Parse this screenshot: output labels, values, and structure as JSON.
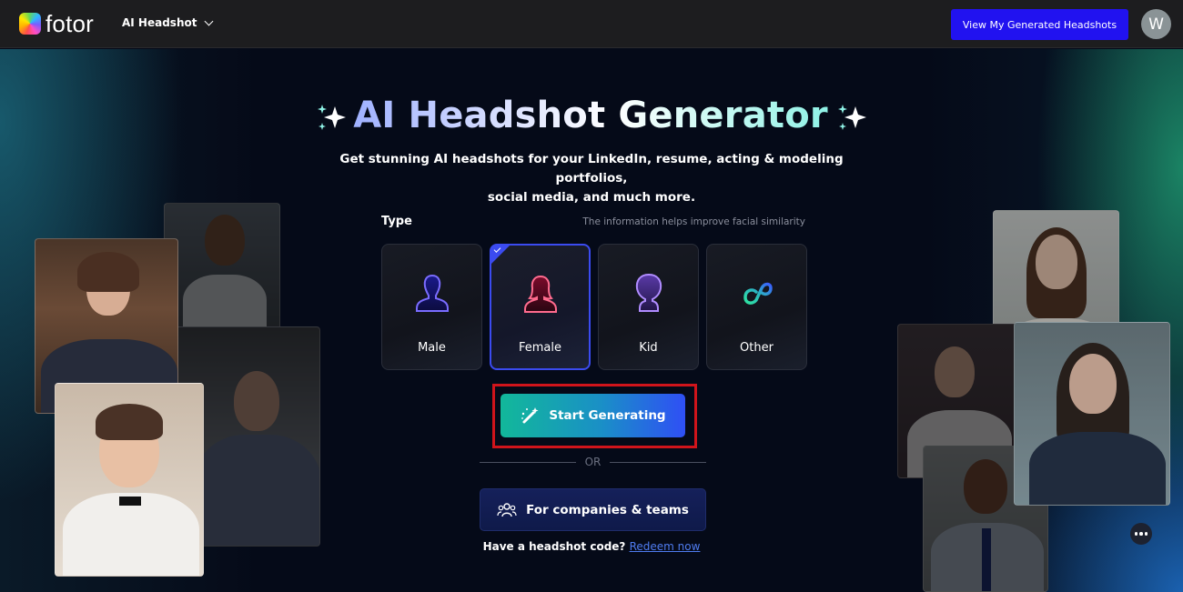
{
  "header": {
    "logo_text": "fotor",
    "nav_menu_label": "AI Headshot",
    "view_button_label": "View My Generated Headshots",
    "avatar_initial": "W"
  },
  "hero": {
    "title": "AI Headshot Generator",
    "subtitle_line1": "Get stunning AI headshots for your LinkedIn, resume, acting & modeling portfolios,",
    "subtitle_line2": "social media, and much more."
  },
  "type_section": {
    "label": "Type",
    "hint": "The information helps improve facial similarity",
    "selected": "Female",
    "options": [
      {
        "label": "Male",
        "icon": "male-person-icon",
        "color": "#6b5cf5"
      },
      {
        "label": "Female",
        "icon": "female-person-icon",
        "color": "#f0587a"
      },
      {
        "label": "Kid",
        "icon": "kid-person-icon",
        "color": "#a37cf7"
      },
      {
        "label": "Other",
        "icon": "infinity-loop-icon",
        "color": "#2fd38f"
      }
    ]
  },
  "actions": {
    "start_label": "Start Generating",
    "or_label": "OR",
    "companies_label": "For companies & teams",
    "redeem_prompt": "Have a headshot code?",
    "redeem_link": "Redeem now"
  },
  "colors": {
    "brand_blue": "#2112f0",
    "selected_border": "#3b4bf0",
    "highlight_red": "#d0141b",
    "start_gradient_from": "#12b89a",
    "start_gradient_to": "#2f4ff5"
  }
}
